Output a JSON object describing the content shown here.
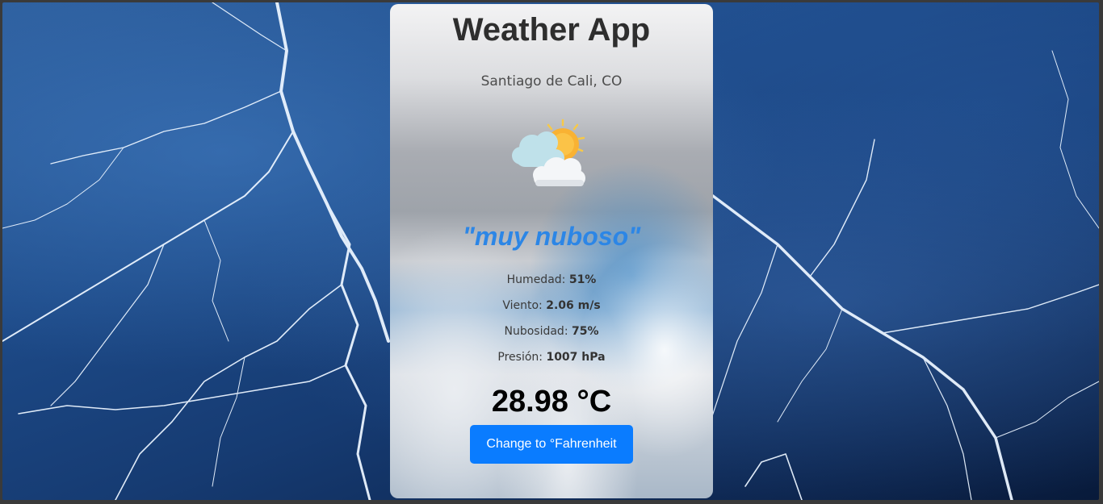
{
  "app": {
    "title": "Weather App",
    "location": "Santiago de Cali, CO",
    "icon": "partly-cloudy-sun-icon",
    "description": "\"muy nuboso\"",
    "stats": [
      {
        "label": "Humedad: ",
        "value": "51%"
      },
      {
        "label": "Viento: ",
        "value": "2.06 m/s"
      },
      {
        "label": "Nubosidad: ",
        "value": "75%"
      },
      {
        "label": "Presión: ",
        "value": "1007 hPa"
      }
    ],
    "temperature": "28.98 °C",
    "toggle_button_label": "Change to °Fahrenheit"
  },
  "colors": {
    "description": "#2c86e6",
    "button": "#0a7cff",
    "background": "#1d4a88"
  },
  "background_image": "lightning-storm"
}
